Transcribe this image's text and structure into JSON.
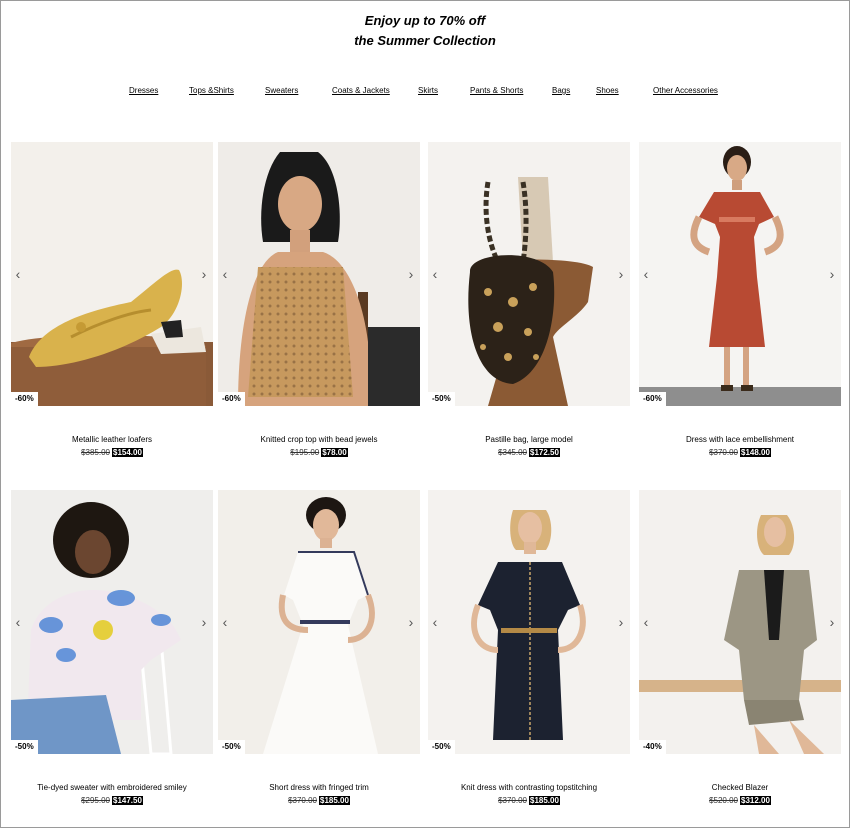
{
  "promo": {
    "line1": "Enjoy up to 70% off",
    "line2": "the Summer Collection"
  },
  "nav": [
    {
      "label": "Dresses"
    },
    {
      "label": "Tops &Shirts"
    },
    {
      "label": "Sweaters"
    },
    {
      "label": "Coats & Jackets"
    },
    {
      "label": "Skirts"
    },
    {
      "label": "Pants & Shorts"
    },
    {
      "label": "Bags"
    },
    {
      "label": "Shoes"
    },
    {
      "label": "Other Accessories"
    }
  ],
  "products": [
    {
      "name": "Metallic leather loafers",
      "old_price": "$385.00",
      "new_price": "$154.00",
      "discount": "-60%"
    },
    {
      "name": "Knitted crop top with bead jewels",
      "old_price": "$195.00",
      "new_price": "$78.00",
      "discount": "-60%"
    },
    {
      "name": "Pastille bag, large model",
      "old_price": "$345.00",
      "new_price": "$172.50",
      "discount": "-50%"
    },
    {
      "name": "Dress with lace embellishment",
      "old_price": "$370.00",
      "new_price": "$148.00",
      "discount": "-60%"
    },
    {
      "name": "Tie-dyed sweater with embroidered smiley",
      "old_price": "$295.00",
      "new_price": "$147.50",
      "discount": "-50%"
    },
    {
      "name": "Short dress with fringed trim",
      "old_price": "$370.00",
      "new_price": "$185.00",
      "discount": "-50%"
    },
    {
      "name": "Knit dress with contrasting topstitching",
      "old_price": "$370.00",
      "new_price": "$185.00",
      "discount": "-50%"
    },
    {
      "name": "Checked Blazer",
      "old_price": "$520.00",
      "new_price": "$312.00",
      "discount": "-40%"
    }
  ],
  "icons": {
    "prev": "chevron-left-icon",
    "next": "chevron-right-icon"
  }
}
